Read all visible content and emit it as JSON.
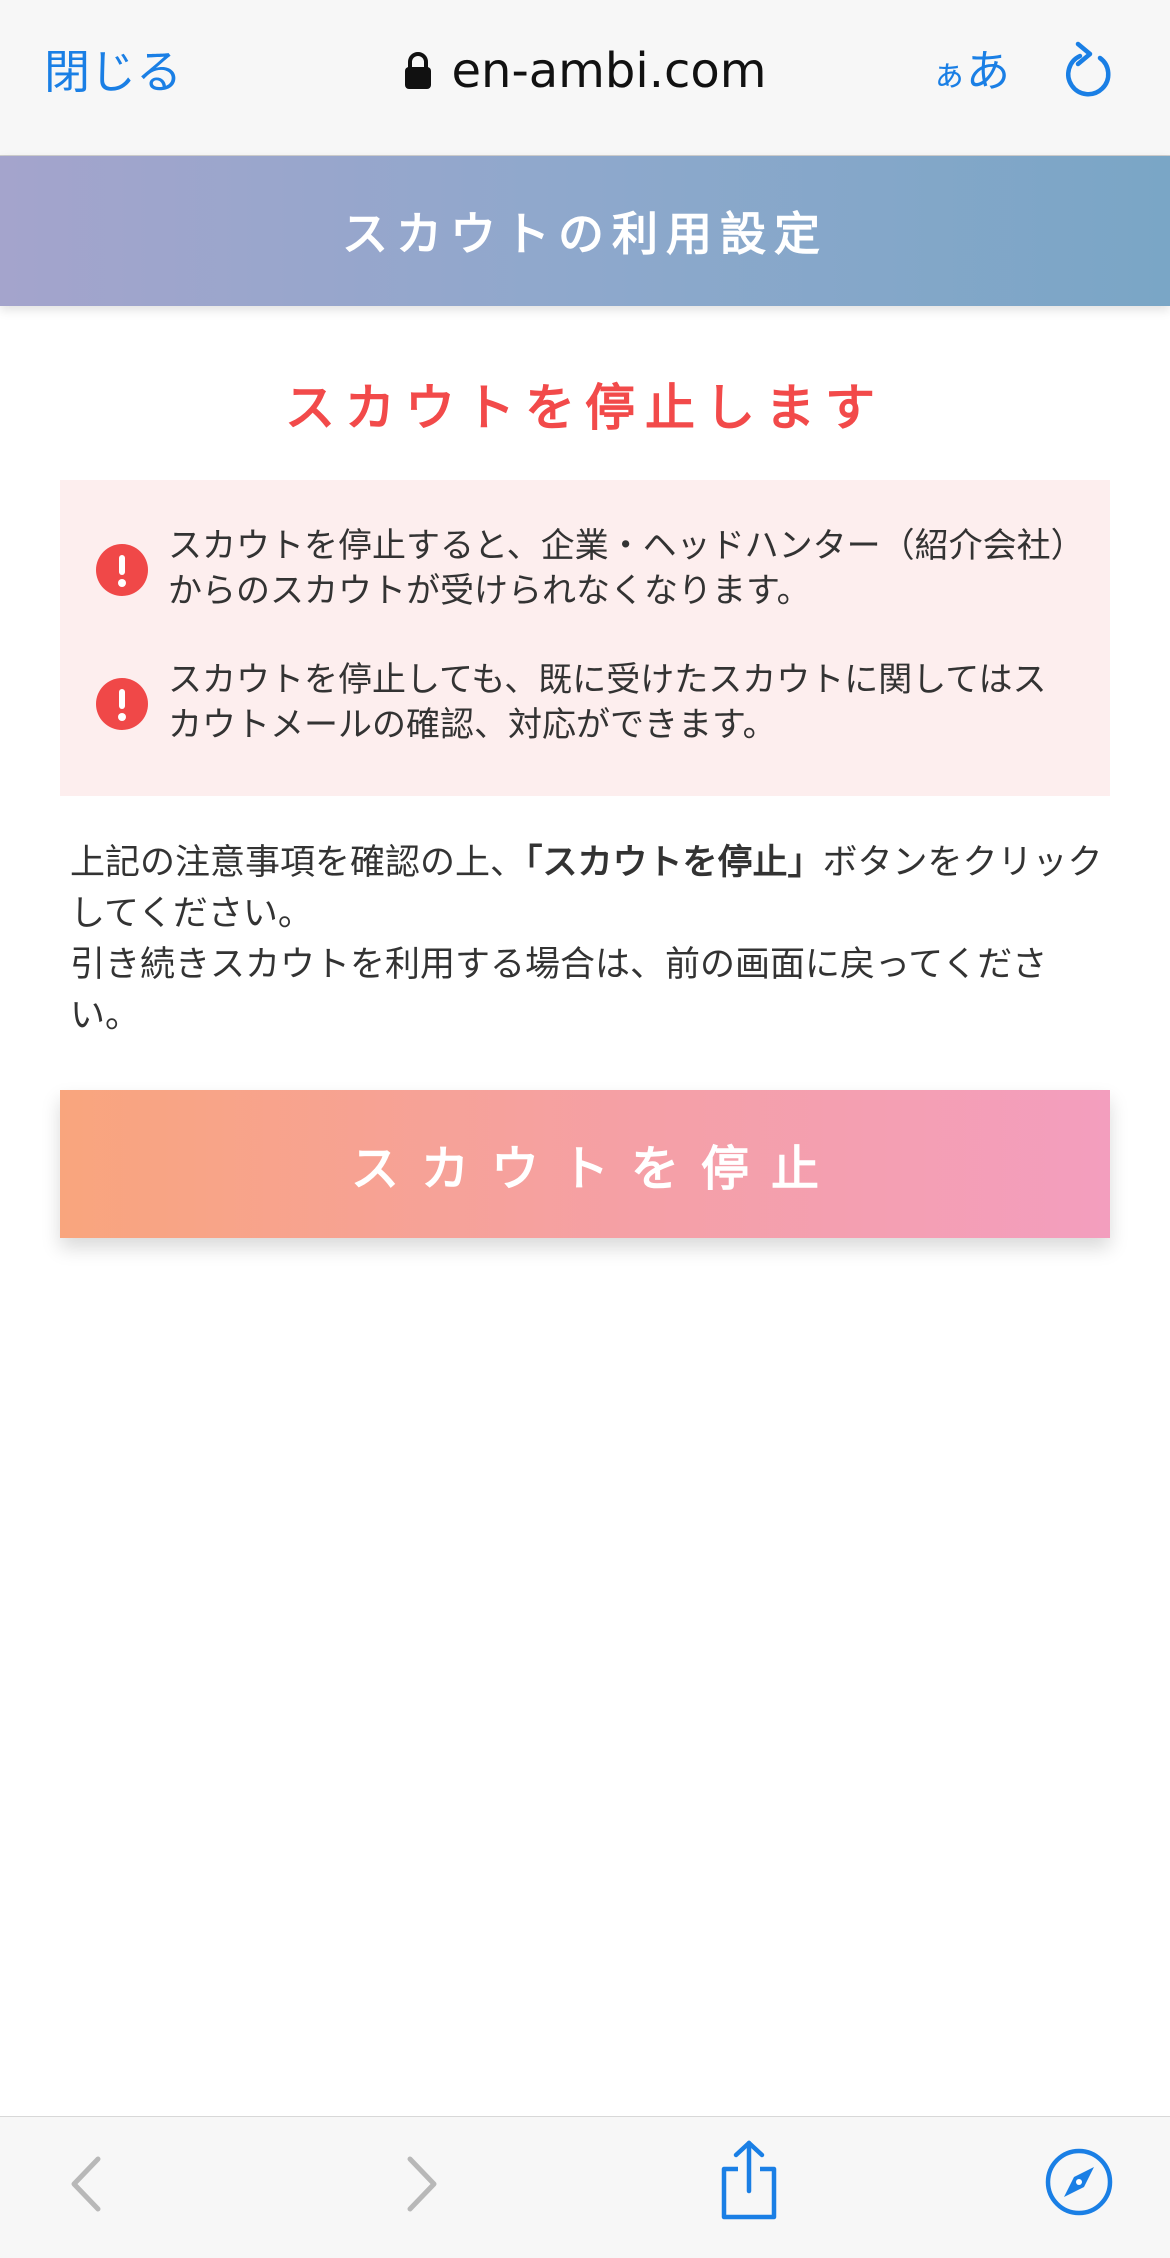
{
  "browser": {
    "close_label": "閉じる",
    "url": "en-ambi.com",
    "text_size_small": "ぁ",
    "text_size_big": "あ",
    "icons": {
      "lock": "lock-icon",
      "reload": "reload-icon",
      "back": "chevron-left-icon",
      "forward": "chevron-right-icon",
      "share": "share-icon",
      "safari": "compass-icon"
    }
  },
  "page": {
    "title": "スカウトの利用設定",
    "heading": "スカウトを停止します",
    "warnings": [
      "スカウトを停止すると、企業・ヘッドハンター（紹介会社）からのスカウトが受けられなくなります。",
      "スカウトを停止しても、既に受けたスカウトに関してはスカウトメールの確認、対応ができます。"
    ],
    "instruction": {
      "part1": "上記の注意事項を確認の上、",
      "bold": "「スカウトを停止」",
      "part2": "ボタンをクリックしてください。",
      "line2": "引き続きスカウトを利用する場合は、前の画面に戻ってください。"
    },
    "stop_button_label": "スカウトを停止"
  },
  "colors": {
    "accent_blue": "#1a7fe5",
    "alert_red": "#f24a4a",
    "warning_bg": "#fdeeee",
    "header_gradient": [
      "#a4a4cc",
      "#7aa6c6"
    ],
    "button_gradient": [
      "#f9a57d",
      "#f39ebe"
    ]
  }
}
